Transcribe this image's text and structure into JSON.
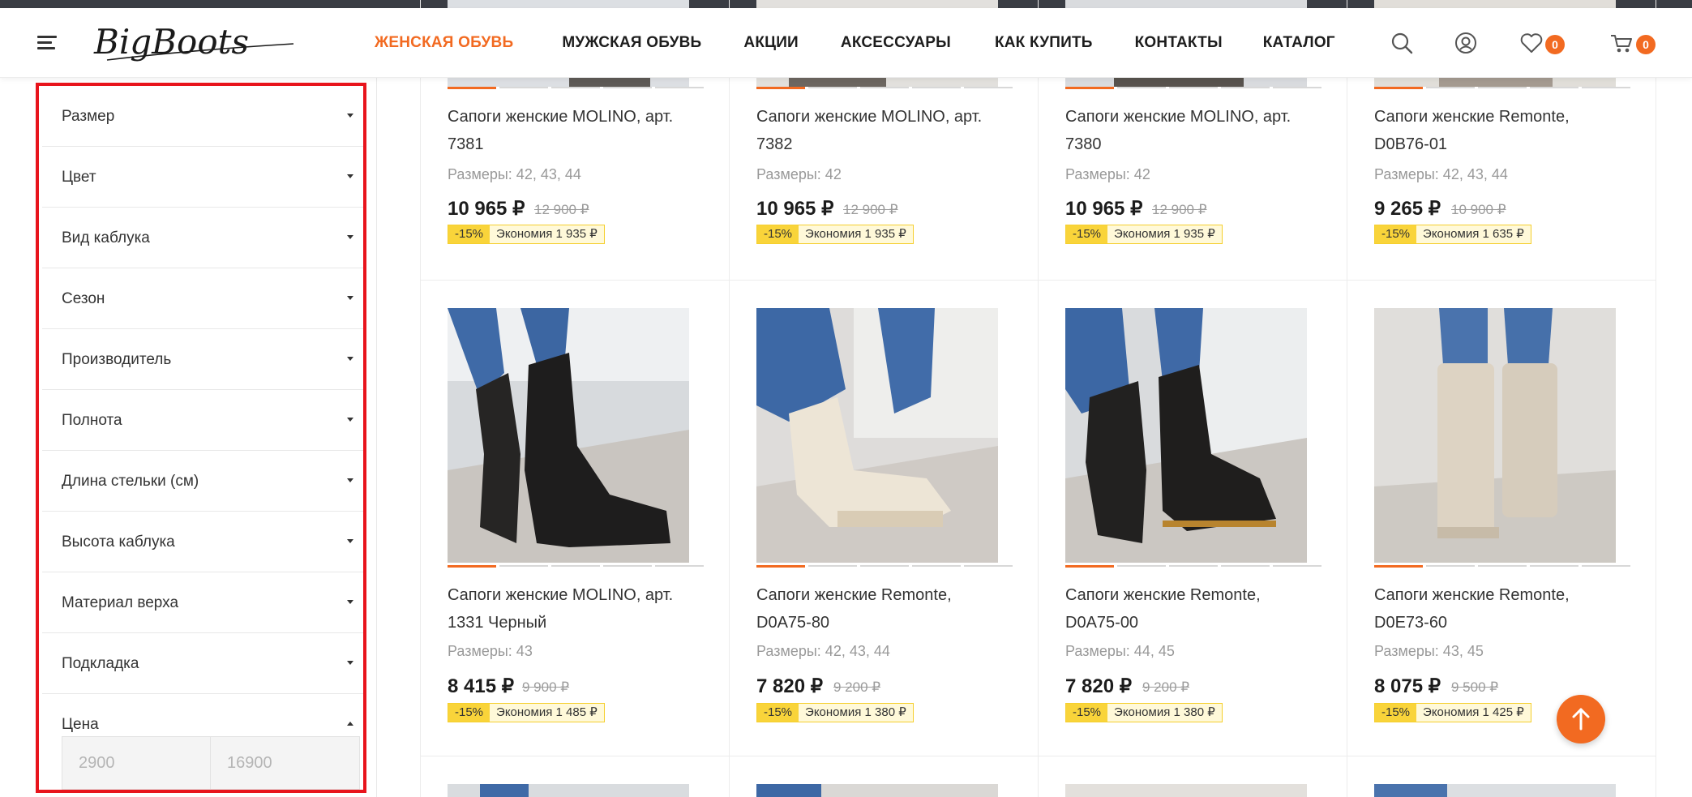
{
  "header": {
    "logo_text": "BigBoots",
    "nav": [
      {
        "label": "ЖЕНСКАЯ ОБУВЬ",
        "active": true
      },
      {
        "label": "МУЖСКАЯ ОБУВЬ",
        "active": false
      },
      {
        "label": "АКЦИИ",
        "active": false
      },
      {
        "label": "АКСЕССУАРЫ",
        "active": false
      },
      {
        "label": "КАК КУПИТЬ",
        "active": false
      },
      {
        "label": "КОНТАКТЫ",
        "active": false
      },
      {
        "label": "КАТАЛОГ",
        "active": false
      }
    ],
    "icons": [
      "search-icon",
      "account-icon",
      "heart-icon",
      "cart-icon"
    ],
    "wishlist_count": "0",
    "cart_count": "0"
  },
  "filters": {
    "items": [
      {
        "label": "Размер",
        "expanded": false
      },
      {
        "label": "Цвет",
        "expanded": false
      },
      {
        "label": "Вид каблука",
        "expanded": false
      },
      {
        "label": "Сезон",
        "expanded": false
      },
      {
        "label": "Производитель",
        "expanded": false
      },
      {
        "label": "Полнота",
        "expanded": false
      },
      {
        "label": "Длина стельки (см)",
        "expanded": false
      },
      {
        "label": "Высота каблука",
        "expanded": false
      },
      {
        "label": "Материал верха",
        "expanded": false
      },
      {
        "label": "Подкладка",
        "expanded": false
      },
      {
        "label": "Цена",
        "expanded": true
      }
    ],
    "price_min_placeholder": "2900",
    "price_max_placeholder": "16900"
  },
  "products": [
    {
      "title_line1": "Сапоги женские MOLINO, арт.",
      "title_line2": "7381",
      "sizes": "Размеры: 42, 43, 44",
      "price": "10 965 ₽",
      "old_price": "12 900 ₽",
      "discount": "-15%",
      "saving": "Экономия 1 935 ₽"
    },
    {
      "title_line1": "Сапоги женские MOLINO, арт.",
      "title_line2": "7382",
      "sizes": "Размеры: 42",
      "price": "10 965 ₽",
      "old_price": "12 900 ₽",
      "discount": "-15%",
      "saving": "Экономия 1 935 ₽"
    },
    {
      "title_line1": "Сапоги женские MOLINO, арт.",
      "title_line2": "7380",
      "sizes": "Размеры: 42",
      "price": "10 965 ₽",
      "old_price": "12 900 ₽",
      "discount": "-15%",
      "saving": "Экономия 1 935 ₽"
    },
    {
      "title_line1": "Сапоги женские Remonte,",
      "title_line2": "D0B76-01",
      "sizes": "Размеры: 42, 43, 44",
      "price": "9 265 ₽",
      "old_price": "10 900 ₽",
      "discount": "-15%",
      "saving": "Экономия 1 635 ₽"
    },
    {
      "title_line1": "Сапоги женские MOLINO, арт.",
      "title_line2": "1331 Черный",
      "sizes": "Размеры: 43",
      "price": "8 415 ₽",
      "old_price": "9 900 ₽",
      "discount": "-15%",
      "saving": "Экономия 1 485 ₽"
    },
    {
      "title_line1": "Сапоги женские Remonte,",
      "title_line2": "D0A75-80",
      "sizes": "Размеры: 42, 43, 44",
      "price": "7 820 ₽",
      "old_price": "9 200 ₽",
      "discount": "-15%",
      "saving": "Экономия 1 380 ₽"
    },
    {
      "title_line1": "Сапоги женские Remonte,",
      "title_line2": "D0A75-00",
      "sizes": "Размеры: 44, 45",
      "price": "7 820 ₽",
      "old_price": "9 200 ₽",
      "discount": "-15%",
      "saving": "Экономия 1 380 ₽"
    },
    {
      "title_line1": "Сапоги женские Remonte,",
      "title_line2": "D0E73-60",
      "sizes": "Размеры: 43, 45",
      "price": "8 075 ₽",
      "old_price": "9 500 ₽",
      "discount": "-15%",
      "saving": "Экономия 1 425 ₽"
    }
  ],
  "colors": {
    "accent": "#f26a21",
    "filter_highlight": "#e8141c",
    "discount_badge": "#f9d43a"
  }
}
